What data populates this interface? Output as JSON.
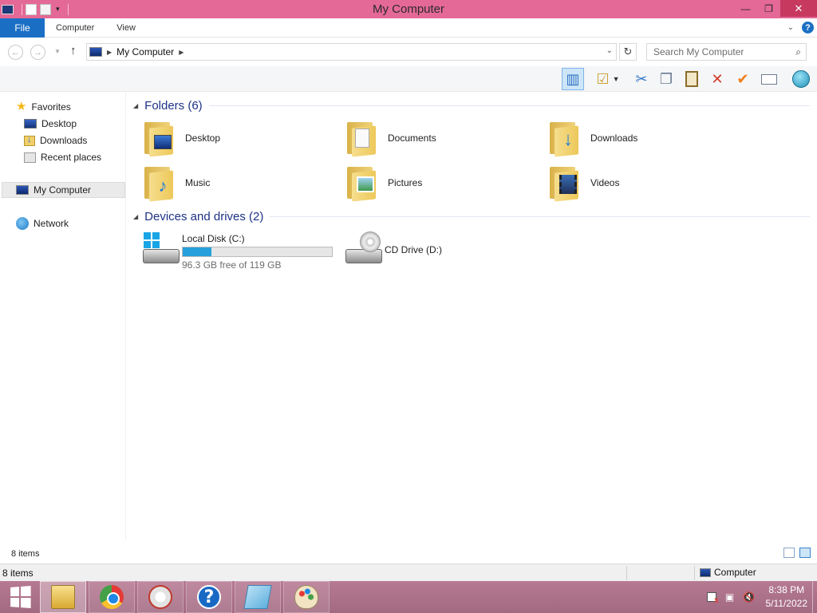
{
  "window": {
    "title": "My Computer",
    "controls": {
      "minimize": "—",
      "restore": "❐",
      "close": "✕"
    }
  },
  "ribbon": {
    "file_tab": "File",
    "tabs": [
      "Computer",
      "View"
    ],
    "help": "?",
    "expand": "⌄"
  },
  "address": {
    "location": "My Computer",
    "search_placeholder": "Search My Computer",
    "back": "←",
    "forward": "→",
    "up": "↑",
    "refresh": "↻",
    "search_icon": "⌕"
  },
  "toolbar": {
    "buttons": [
      {
        "name": "navigation-pane-button",
        "icon": "pane-layout-icon",
        "glyph": "▥",
        "color": "#2f6fc3"
      },
      {
        "name": "properties-button",
        "icon": "checklist-icon",
        "glyph": "☑",
        "color": "#c9a032"
      },
      {
        "name": "cut-button",
        "icon": "scissors-icon",
        "glyph": "✂",
        "color": "#2f76c8"
      },
      {
        "name": "copy-button",
        "icon": "copy-icon",
        "glyph": "❐",
        "color": "#6a7b93"
      },
      {
        "name": "paste-button",
        "icon": "clipboard-icon",
        "glyph": "📋",
        "color": "#8a6d2a"
      },
      {
        "name": "delete-button",
        "icon": "delete-x-icon",
        "glyph": "✕",
        "color": "#d63a2b"
      },
      {
        "name": "select-button",
        "icon": "checkmark-icon",
        "glyph": "✔",
        "color": "#ef7d1a"
      },
      {
        "name": "rename-button",
        "icon": "rename-icon",
        "glyph": "▭",
        "color": "#6f7d8f"
      },
      {
        "name": "network-button",
        "icon": "globe-icon",
        "glyph": "◉",
        "color": "#2aa0c9"
      }
    ]
  },
  "nav": {
    "favorites": "Favorites",
    "desktop": "Desktop",
    "downloads": "Downloads",
    "recent": "Recent places",
    "computer": "My Computer",
    "network": "Network"
  },
  "content": {
    "folders_header": "Folders (6)",
    "folders": [
      {
        "label": "Desktop",
        "icon": "desktop-folder-icon"
      },
      {
        "label": "Documents",
        "icon": "documents-folder-icon"
      },
      {
        "label": "Downloads",
        "icon": "downloads-folder-icon"
      },
      {
        "label": "Music",
        "icon": "music-folder-icon"
      },
      {
        "label": "Pictures",
        "icon": "pictures-folder-icon"
      },
      {
        "label": "Videos",
        "icon": "videos-folder-icon"
      }
    ],
    "drives_header": "Devices and drives (2)",
    "drives": [
      {
        "label": "Local Disk (C:)",
        "free_text": "96.3 GB free of 119 GB",
        "used_fraction": 0.19,
        "icon": "local-disk-icon"
      },
      {
        "label": "CD Drive (D:)",
        "icon": "cd-drive-icon"
      }
    ]
  },
  "status": {
    "items": "8 items",
    "legacy_items": "8 items",
    "zone": "Computer"
  },
  "taskbar": {
    "apps": [
      "file-explorer-icon",
      "chrome-icon",
      "tool-icon",
      "help-icon",
      "notepad-icon",
      "paint-icon"
    ],
    "time": "8:38 PM",
    "date": "5/11/2022"
  },
  "colors": {
    "titlebar": "#e46996",
    "file_tab": "#1a6fc5",
    "group_header": "#1e3287",
    "drive_bar": "#26a0da",
    "taskbar": "#b67a92"
  }
}
